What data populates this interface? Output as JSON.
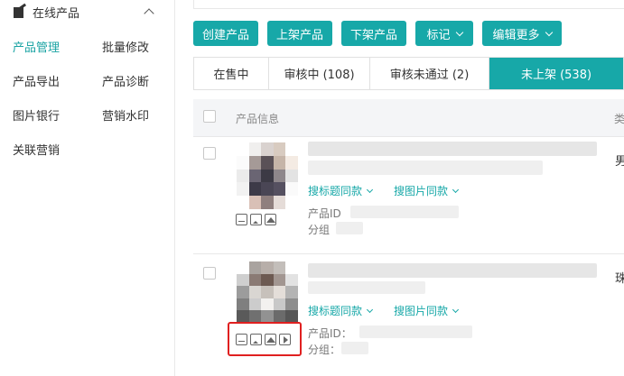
{
  "sidebar": {
    "section_title": "在线产品",
    "items": [
      {
        "label": "产品管理",
        "active": true
      },
      {
        "label": "批量修改",
        "active": false
      },
      {
        "label": "产品导出",
        "active": false
      },
      {
        "label": "产品诊断",
        "active": false
      },
      {
        "label": "图片银行",
        "active": false
      },
      {
        "label": "营销水印",
        "active": false
      },
      {
        "label": "关联营销",
        "active": false
      }
    ]
  },
  "toolbar": {
    "create_label": "创建产品",
    "list_label": "上架产品",
    "delist_label": "下架产品",
    "mark_label": "标记",
    "edit_more_label": "编辑更多"
  },
  "tabs": [
    {
      "label": "在售中",
      "active": false
    },
    {
      "label": "审核中 (108)",
      "active": false
    },
    {
      "label": "审核未通过 (2)",
      "active": false
    },
    {
      "label": "未上架 (538)",
      "active": true
    }
  ],
  "table": {
    "col_product_info": "产品信息",
    "col_category_partial": "类"
  },
  "products": [
    {
      "title_partial": "",
      "similar_title_link": "搜标题同款",
      "similar_image_link": "搜图片同款",
      "id_label": "产品ID",
      "group_label": "分组",
      "category_partial": "男"
    },
    {
      "title_partial": "...y ...",
      "similar_title_link": "搜标题同款",
      "similar_image_link": "搜图片同款",
      "id_label": "产品ID：",
      "group_label": "分组：",
      "category_partial": "珠"
    }
  ],
  "colors": {
    "accent": "#17a8a8",
    "highlight": "#e02020"
  }
}
